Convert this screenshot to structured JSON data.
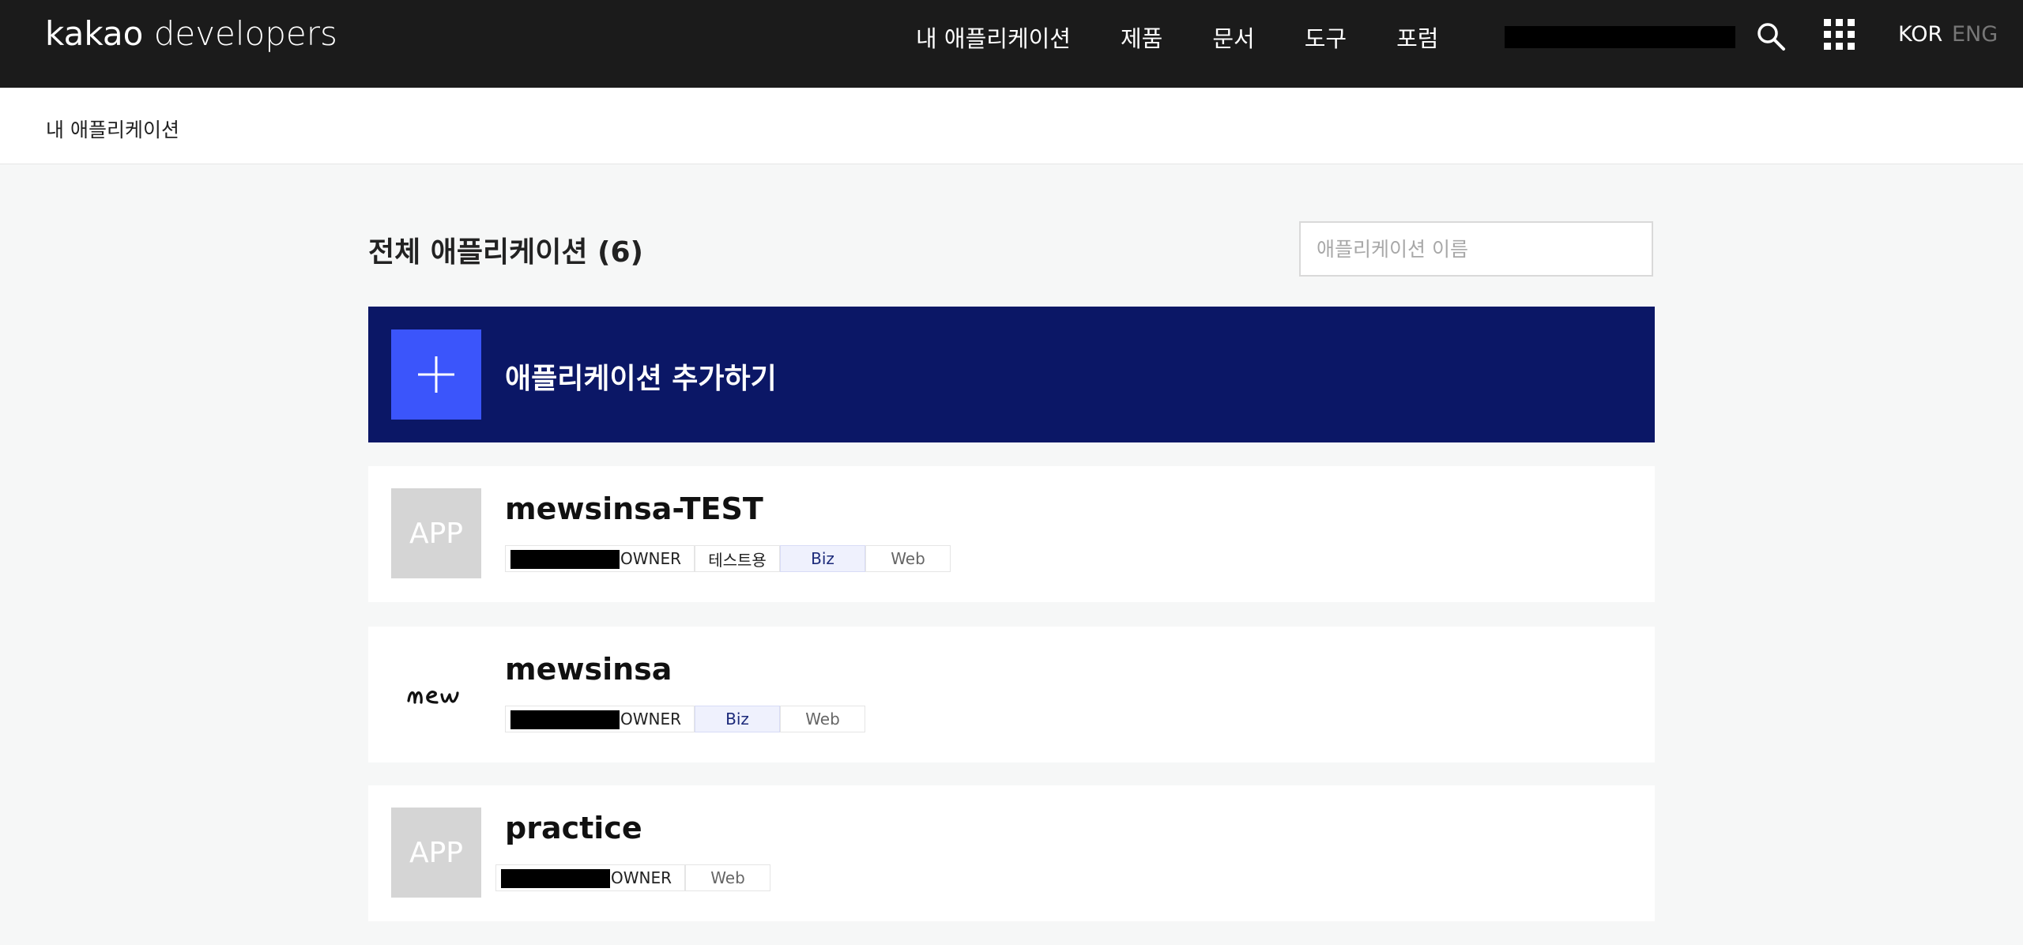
{
  "header": {
    "logo_prefix": "kakao",
    "logo_suffix": " developers",
    "nav": [
      "내 애플리케이션",
      "제품",
      "문서",
      "도구",
      "포럼"
    ],
    "icons": [
      "search-icon",
      "apps-grid-icon"
    ],
    "lang_kor": "KOR",
    "lang_eng": "ENG"
  },
  "breadcrumb": "내 애플리케이션",
  "page": {
    "title": "전체 애플리케이션 (6)",
    "search_placeholder": "애플리케이션 이름"
  },
  "add_app": {
    "label": "애플리케이션 추가하기",
    "icon": "plus-icon"
  },
  "apps": [
    {
      "name": "mewsinsa-TEST",
      "thumb": "APP",
      "role": "OWNER",
      "test_tag": "테스트용",
      "biz": "Biz",
      "platform": "Web"
    },
    {
      "name": "mewsinsa",
      "thumb": "mew",
      "role": "OWNER",
      "biz": "Biz",
      "platform": "Web"
    },
    {
      "name": "practice",
      "thumb": "APP",
      "role": "OWNER",
      "platform": "Web"
    }
  ],
  "colors": {
    "header_bg": "#1b1b1b",
    "add_bg": "#0b1766",
    "add_icon_bg": "#3b55fb",
    "page_bg": "#f6f7f7"
  }
}
